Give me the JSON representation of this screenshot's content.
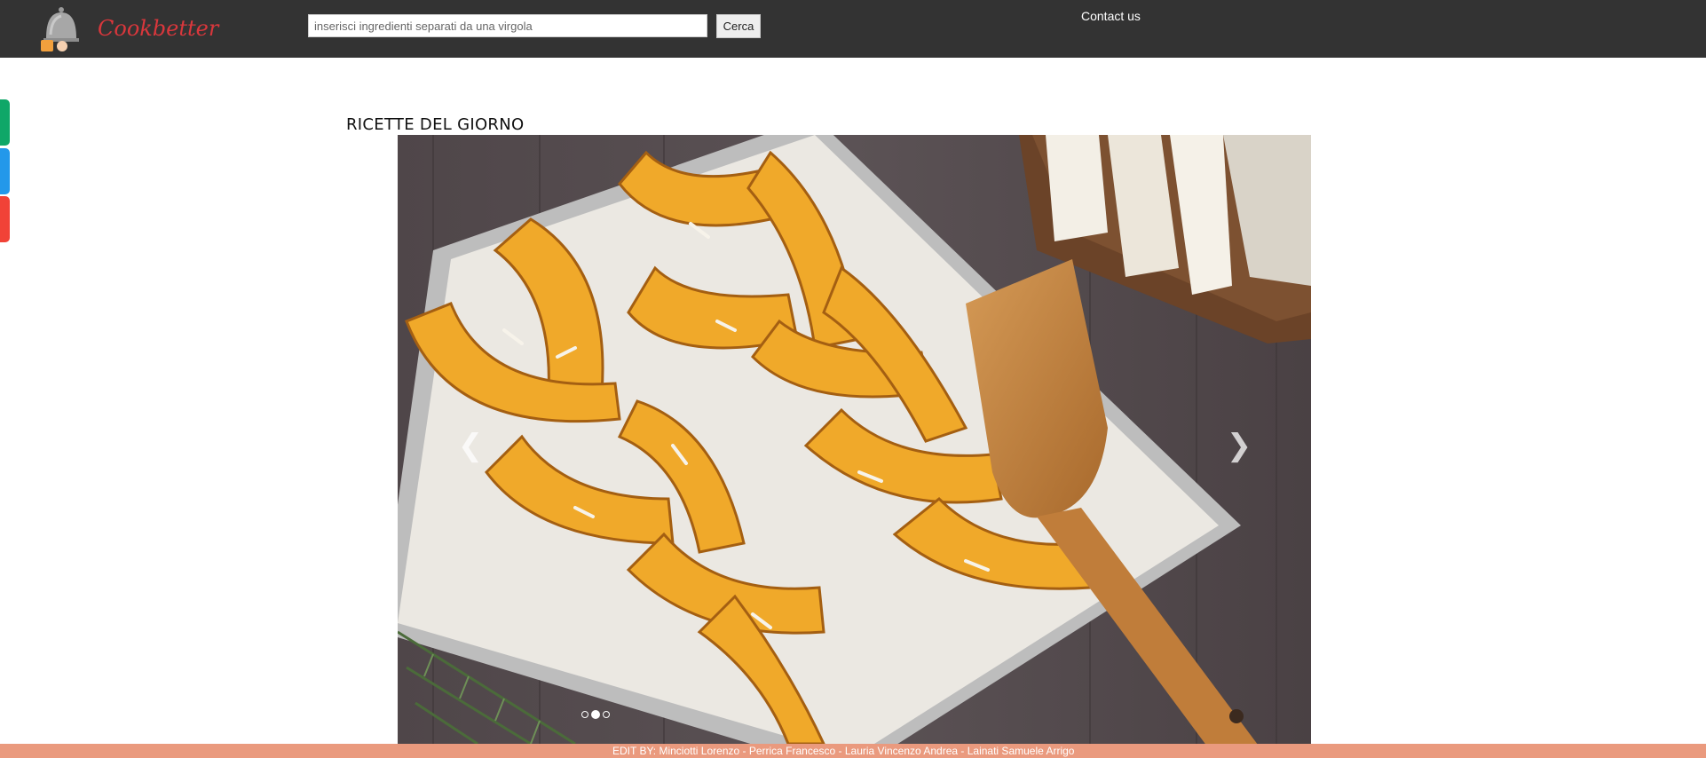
{
  "header": {
    "brand": "Cookbetter",
    "search": {
      "placeholder": "inserisci ingredienti separati da una virgola",
      "value": ""
    },
    "search_button_label": "Cerca",
    "contact_label": "Contact us"
  },
  "share_tabs": [
    {
      "icon": "share-tab-green",
      "color": "#0fa768"
    },
    {
      "icon": "share-tab-blue",
      "color": "#2398ea"
    },
    {
      "icon": "share-tab-red",
      "color": "#f14237"
    }
  ],
  "main": {
    "section_title": "RICETTE DEL GIORNO",
    "carousel": {
      "slide_count": 3,
      "active_index": 1,
      "prev_icon": "chevron-left-icon",
      "next_icon": "chevron-right-icon"
    }
  },
  "footer": {
    "credits": "EDIT BY: Minciotti Lorenzo - Perrica Francesco - Lauria Vincenzo Andrea - Lainati Samuele Arrigo"
  },
  "colors": {
    "header_bg": "#333333",
    "brand": "#d9373c",
    "footer_bg": "#ea9a7e"
  }
}
